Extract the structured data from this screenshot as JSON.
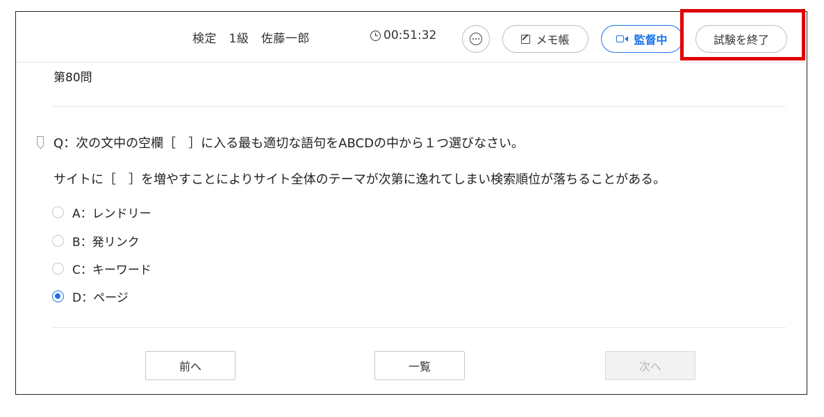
{
  "header": {
    "exam_title": "検定　1級　佐藤一郎",
    "timer": "00:51:32",
    "memo_label": "メモ帳",
    "monitor_label": "監督中",
    "end_label": "試験を終了"
  },
  "question": {
    "number": "第80問",
    "prompt": "Q：次の文中の空欄［　］に入る最も適切な語句をABCDの中から１つ選びなさい。",
    "sentence": "サイトに［　］を増やすことによりサイト全体のテーマが次第に逸れてしまい検索順位が落ちることがある。",
    "choices": [
      {
        "label": "A：レンドリー",
        "selected": false
      },
      {
        "label": "B：発リンク",
        "selected": false
      },
      {
        "label": "C：キーワード",
        "selected": false
      },
      {
        "label": "D：ページ",
        "selected": true
      }
    ]
  },
  "nav": {
    "prev_label": "前へ",
    "list_label": "一覧",
    "next_label": "次へ"
  },
  "colors": {
    "accent": "#1a73e8",
    "highlight": "#e00000"
  }
}
